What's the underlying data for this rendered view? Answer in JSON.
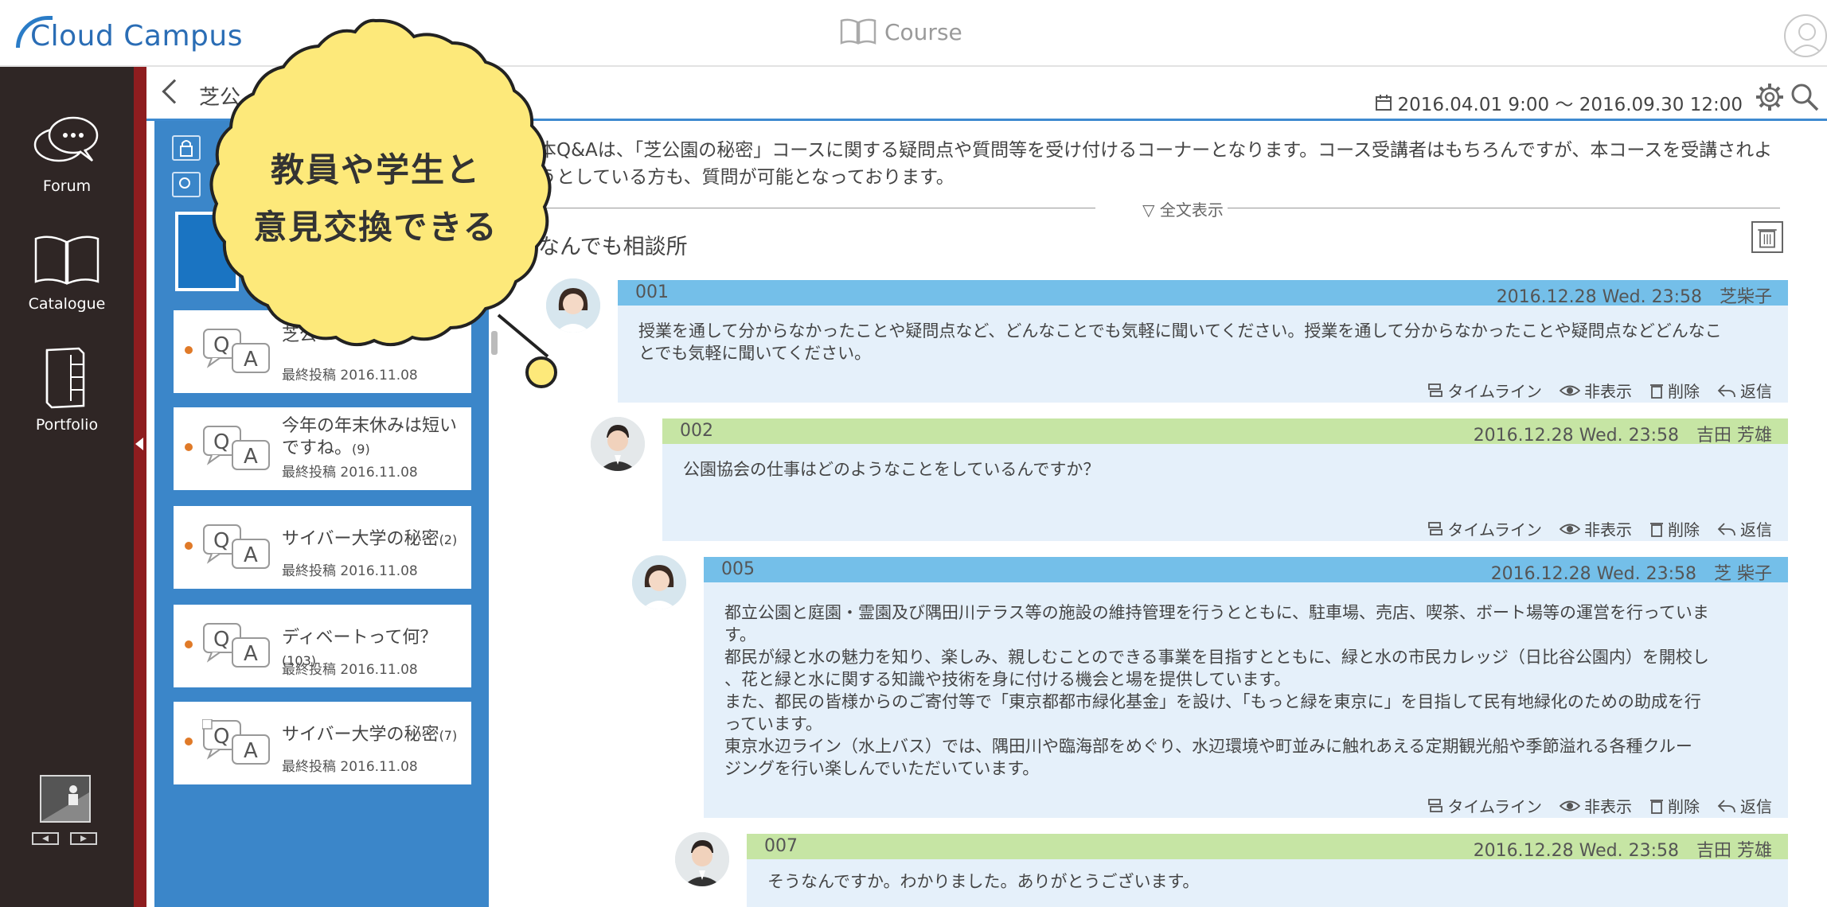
{
  "header": {
    "logo": "Cloud Campus",
    "center_label": "Course"
  },
  "leftnav": {
    "items": [
      {
        "label": "Forum",
        "icon": "speech-bubbles-icon"
      },
      {
        "label": "Catalogue",
        "icon": "open-book-icon"
      },
      {
        "label": "Portfolio",
        "icon": "binder-icon"
      }
    ]
  },
  "subheader": {
    "title": "芝公",
    "period": "2016.04.01 9:00 ～ 2016.09.30 12:00"
  },
  "threads": [
    {
      "title": "芝公",
      "count": "",
      "meta": "最終投稿 2016.11.08"
    },
    {
      "title": "今年の年末休みは短いですね。",
      "count": "(9)",
      "meta": "最終投稿 2016.11.08"
    },
    {
      "title": "サイバー大学の秘密",
      "count": "(2)",
      "meta": "最終投稿 2016.11.08"
    },
    {
      "title": "ディベートって何？",
      "count": "(103)",
      "meta": "最終投稿 2016.11.08"
    },
    {
      "title": "サイバー大学の秘密",
      "count": "(7)",
      "meta": "最終投稿 2016.11.08"
    }
  ],
  "main": {
    "description": "本Q&Aは、「芝公園の秘密」コースに関する疑問点や質問等を受け付けるコーナーとなります。コース受講者はもちろんですが、本コースを受講されようとしている方も、質問が可能となっております。",
    "full_text_label": "▽ 全文表示",
    "forum_title": "なんでも相談所"
  },
  "actions": {
    "timeline": "タイムライン",
    "hide": "非表示",
    "delete": "削除",
    "reply": "返信"
  },
  "posts": [
    {
      "num": "001",
      "datetime": "2016.12.28 Wed. 23:58　芝柴子",
      "text": "授業を通して分からなかったことや疑問点など、どんなことでも気軽に聞いてください。授業を通して分からなかったことや疑問点などどんなことでも気軽に聞いてください。"
    },
    {
      "num": "002",
      "datetime": "2016.12.28 Wed. 23:58　吉田 芳雄",
      "text": "公園協会の仕事はどのようなことをしているんですか？"
    },
    {
      "num": "005",
      "datetime": "2016.12.28 Wed. 23:58　芝 柴子",
      "text_lines": [
        "都立公園と庭園・霊園及び隅田川テラス等の施設の維持管理を行うとともに、駐車場、売店、喫茶、ボート場等の運営を行っていま",
        "す。",
        "都民が緑と水の魅力を知り、楽しみ、親しむことのできる事業を目指すとともに、緑と水の市民カレッジ（日比谷公園内）を開校し",
        "、花と緑と水に関する知識や技術を身に付ける機会と場を提供しています。",
        "また、都民の皆様からのご寄付等で「東京都都市緑化基金」を設け、「もっと緑を東京に」を目指して民有地緑化のための助成を行",
        "っています。",
        "東京水辺ライン（水上バス）では、隅田川や臨海部をめぐり、水辺環境や町並みに触れあえる定期観光船や季節溢れる各種クルー",
        "ジングを行い楽しんでいただいています。"
      ]
    },
    {
      "num": "007",
      "datetime": "2016.12.28 Wed. 23:58　吉田 芳雄",
      "text": "そうなんですか。わかりました。ありがとうございます。"
    }
  ],
  "callout": {
    "line1": "教員や学生と",
    "line2": "意見交換できる"
  },
  "colors": {
    "accent_blue": "#3b86c9",
    "post_blue_header": "#74bfe9",
    "post_green_header": "#c6e5a4",
    "post_body": "#e5f0fa",
    "nav_dark": "#2f2625",
    "nav_strip": "#8e1d1f",
    "callout_yellow": "#fde97a",
    "unread_dot": "#e07a28"
  }
}
